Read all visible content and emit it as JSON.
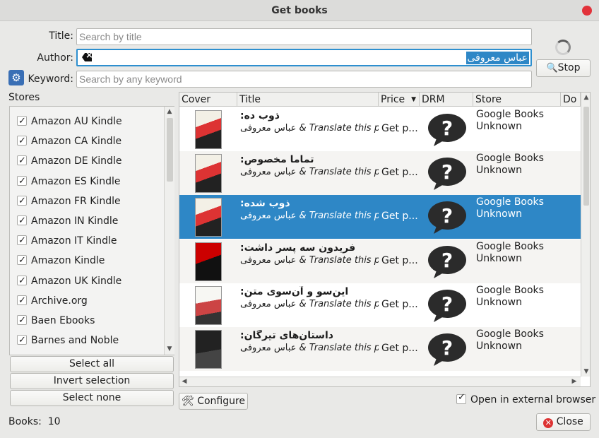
{
  "window": {
    "title": "Get books"
  },
  "search": {
    "title_label": "Title:",
    "title_underline": "T",
    "title_placeholder": "Search by title",
    "author_label": "Author:",
    "author_underline": "A",
    "author_value": "عباس معروفی",
    "keyword_label": "Keyword:",
    "keyword_underline": "K",
    "keyword_placeholder": "Search by any keyword",
    "stop_label": "Stop",
    "stop_underline": "S"
  },
  "stores": {
    "label": "Stores",
    "items": [
      {
        "label": "Amazon AU Kindle",
        "checked": true
      },
      {
        "label": "Amazon CA Kindle",
        "checked": true
      },
      {
        "label": "Amazon DE Kindle",
        "checked": true
      },
      {
        "label": "Amazon ES Kindle",
        "checked": true
      },
      {
        "label": "Amazon FR Kindle",
        "checked": true
      },
      {
        "label": "Amazon IN Kindle",
        "checked": true
      },
      {
        "label": "Amazon IT Kindle",
        "checked": true
      },
      {
        "label": "Amazon Kindle",
        "checked": true
      },
      {
        "label": "Amazon UK Kindle",
        "checked": true
      },
      {
        "label": "Archive.org",
        "checked": true
      },
      {
        "label": "Baen Ebooks",
        "checked": true
      },
      {
        "label": "Barnes and Noble",
        "checked": true
      }
    ],
    "select_all": "Select all",
    "invert_selection": "Invert selection",
    "select_none": "Select none"
  },
  "table": {
    "columns": [
      "Cover",
      "Title",
      "Price",
      "DRM",
      "Store",
      "Do"
    ],
    "rows": [
      {
        "title": "ذوب ده:",
        "author_ar": "عباس معروفی",
        "author_en": " & Translate this pag",
        "price": "Get p...",
        "store": "Google Books",
        "drm": "Unknown",
        "selected": false
      },
      {
        "title": "تماما مخصوص:",
        "author_ar": "عباس معروفی",
        "author_en": " & Translate this pag",
        "price": "Get p...",
        "store": "Google Books",
        "drm": "Unknown",
        "selected": false
      },
      {
        "title": "ذوب شده:",
        "author_ar": "عباس معروفی",
        "author_en": " & Translate this pag",
        "price": "Get p...",
        "store": "Google Books",
        "drm": "Unknown",
        "selected": true
      },
      {
        "title": "فریدون سه پسر داشت:",
        "author_ar": "عباس معروفی",
        "author_en": " & Translate this pag",
        "price": "Get p...",
        "store": "Google Books",
        "drm": "Unknown",
        "selected": false
      },
      {
        "title": "این‌سو و آن‌سوی متن:",
        "author_ar": "عباس معروفی",
        "author_en": " & Translate this pag",
        "price": "Get p...",
        "store": "Google Books",
        "drm": "Unknown",
        "selected": false
      },
      {
        "title": "داستان‌های تیرگان:",
        "author_ar": "عباس معروفی",
        "author_en": " & Translate this pag",
        "price": "Get p...",
        "store": "Google Books",
        "drm": "Unknown",
        "selected": false
      }
    ]
  },
  "footer": {
    "configure": "Configure",
    "configure_underline": "C",
    "open_external": "Open in external browser",
    "books_label": "Books:",
    "books_count": "10",
    "close": "Close",
    "close_underline": "C"
  },
  "colors": {
    "accent": "#2e87c6",
    "close_dot": "#e2323a"
  }
}
